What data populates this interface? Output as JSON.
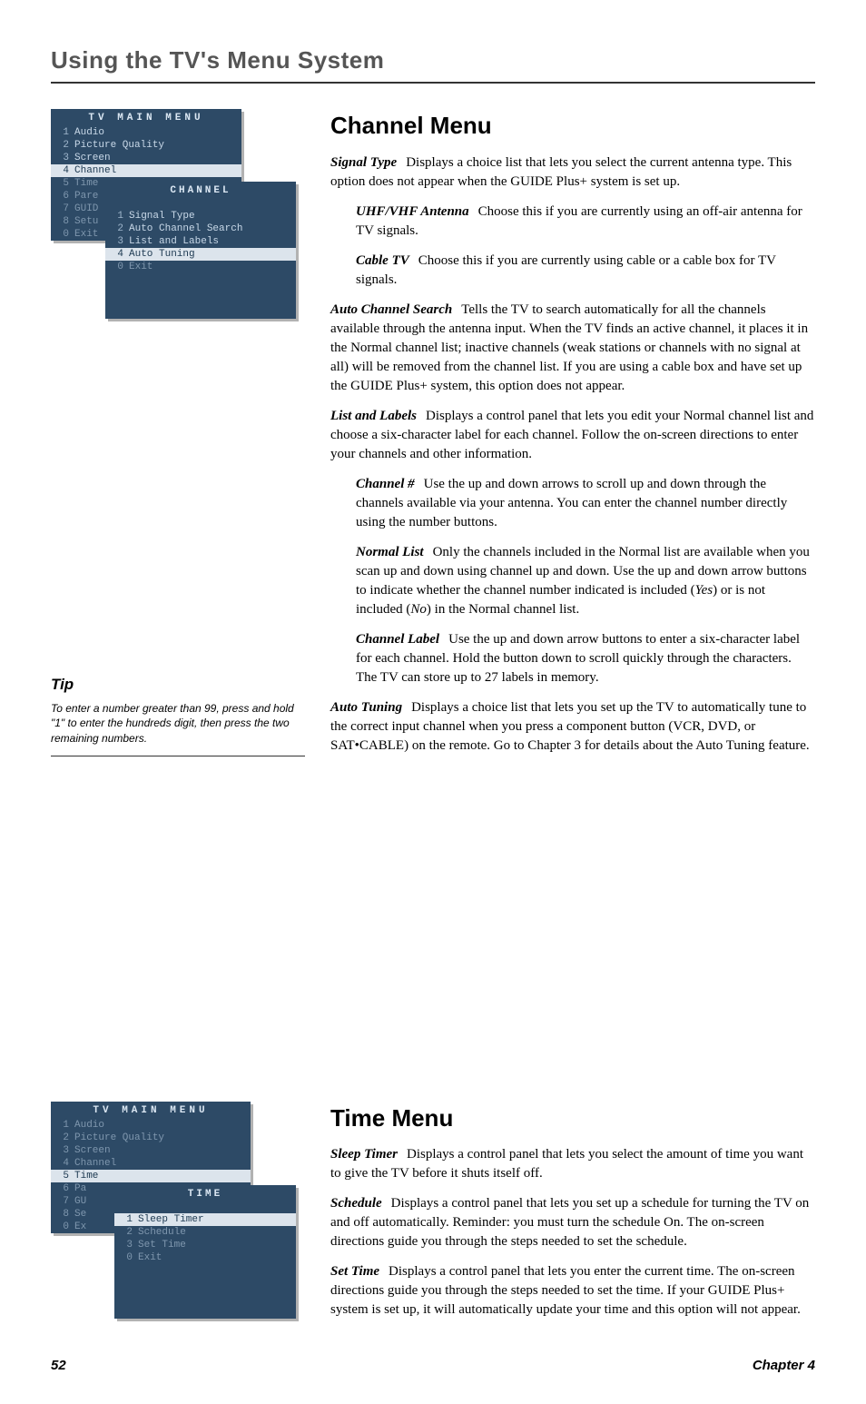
{
  "page": {
    "title": "Using the TV's Menu System",
    "footer_left": "52",
    "footer_right": "Chapter 4"
  },
  "tip": {
    "heading": "Tip",
    "body": "To enter a number greater than 99, press and hold \"1\" to enter the hundreds digit, then press the two remaining numbers."
  },
  "tv1": {
    "main_title": "TV MAIN MENU",
    "items": [
      {
        "n": "1",
        "label": "Audio"
      },
      {
        "n": "2",
        "label": "Picture Quality"
      },
      {
        "n": "3",
        "label": "Screen"
      },
      {
        "n": "4",
        "label": "Channel"
      },
      {
        "n": "5",
        "label": "Time"
      },
      {
        "n": "6",
        "label": "Pare"
      },
      {
        "n": "7",
        "label": "GUID"
      },
      {
        "n": "8",
        "label": "Setu"
      },
      {
        "n": "0",
        "label": "Exit"
      }
    ],
    "sub_title": "CHANNEL",
    "sub_items": [
      {
        "n": "1",
        "label": "Signal Type"
      },
      {
        "n": "2",
        "label": "Auto Channel Search"
      },
      {
        "n": "3",
        "label": "List and Labels"
      },
      {
        "n": "4",
        "label": "Auto Tuning"
      },
      {
        "n": "0",
        "label": "Exit"
      }
    ]
  },
  "tv2": {
    "main_title": "TV MAIN MENU",
    "items": [
      {
        "n": "1",
        "label": "Audio"
      },
      {
        "n": "2",
        "label": "Picture Quality"
      },
      {
        "n": "3",
        "label": "Screen"
      },
      {
        "n": "4",
        "label": "Channel"
      },
      {
        "n": "5",
        "label": "Time"
      },
      {
        "n": "6",
        "label": "Pa"
      },
      {
        "n": "7",
        "label": "GU"
      },
      {
        "n": "8",
        "label": "Se"
      },
      {
        "n": "0",
        "label": "Ex"
      }
    ],
    "sub_title": "TIME",
    "sub_items": [
      {
        "n": "1",
        "label": "Sleep Timer"
      },
      {
        "n": "2",
        "label": "Schedule"
      },
      {
        "n": "3",
        "label": "Set Time"
      },
      {
        "n": "0",
        "label": "Exit"
      }
    ]
  },
  "channel": {
    "heading": "Channel Menu",
    "signal_type_term": "Signal Type",
    "signal_type_body": "Displays a choice list that lets you select the current antenna type. This option does not appear when the GUIDE Plus+ system is set up.",
    "uhf_term": "UHF/VHF Antenna",
    "uhf_body": "Choose this if you are currently using an off-air antenna for TV signals.",
    "cable_term": "Cable TV",
    "cable_body": "Choose this if you are currently using cable or a cable box for TV signals.",
    "auto_search_term": "Auto Channel Search",
    "auto_search_body": "Tells the TV to search automatically for all the channels available through the antenna input. When the TV finds an active channel, it places it in the Normal channel list; inactive channels (weak stations or channels with no signal at all) will be removed from the channel list. If you are using a cable box and have set up the GUIDE Plus+ system, this option does not appear.",
    "list_labels_term": "List and Labels",
    "list_labels_body": "Displays a control panel that lets you edit your Normal channel list and choose a six-character label for each channel. Follow the on-screen directions to enter your channels and other information.",
    "chnum_term": "Channel #",
    "chnum_body": "Use the up and down arrows to scroll up and down through the channels available via your antenna. You can enter the channel number directly using the number buttons.",
    "normal_term": "Normal List",
    "normal_body_a": "Only the channels included in the Normal list are available when you scan up and down using channel up and down. Use the up and down arrow buttons to indicate whether the channel number indicated is included (",
    "normal_yes": "Yes",
    "normal_body_b": ") or is not included (",
    "normal_no": "No",
    "normal_body_c": ") in the Normal channel list.",
    "chlabel_term": "Channel Label",
    "chlabel_body": "Use the up and down arrow buttons to enter a six-character label for each channel. Hold the button down to scroll quickly through the characters. The TV can store up to 27 labels in memory.",
    "auto_tuning_term": "Auto Tuning",
    "auto_tuning_body": "Displays a choice list that lets you set up the TV to automatically tune to the correct input channel when you press a component button (VCR, DVD, or SAT•CABLE) on the remote. Go to Chapter 3 for details about the Auto Tuning feature."
  },
  "time": {
    "heading": "Time Menu",
    "sleep_term": "Sleep Timer",
    "sleep_body": "Displays a control panel that lets you select the amount of time you want to give the TV before it shuts itself off.",
    "schedule_term": "Schedule",
    "schedule_body": "Displays a control panel that lets you set up a schedule for turning the TV on and off automatically. Reminder: you must turn the schedule On. The on-screen directions guide you through the steps needed to set the schedule.",
    "settime_term": "Set Time",
    "settime_body": "Displays a control panel that lets you enter the current time. The on-screen directions guide you through the steps needed to set the time. If your GUIDE Plus+ system is set up, it will automatically update your time and this option will not appear."
  }
}
